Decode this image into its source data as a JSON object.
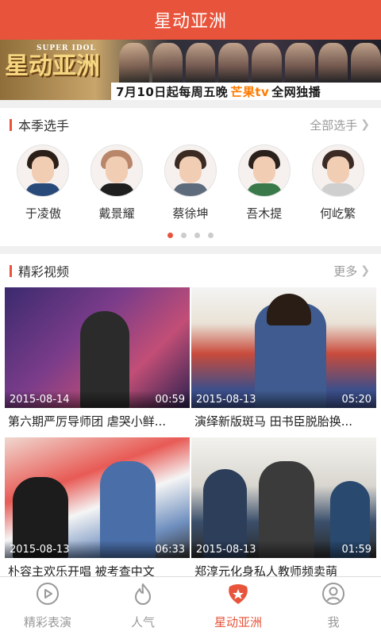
{
  "header": {
    "title": "星动亚洲"
  },
  "banner": {
    "logo_text": "星动亚洲",
    "logo_sub": "SUPER IDOL",
    "slogan_prefix": "7月10日起每周五晚",
    "slogan_brand": "芒果tv",
    "slogan_suffix": "全网独播"
  },
  "season": {
    "title": "本季选手",
    "more_label": "全部选手",
    "players": [
      {
        "name": "于凌傲"
      },
      {
        "name": "戴景耀"
      },
      {
        "name": "蔡徐坤"
      },
      {
        "name": "吾木提"
      },
      {
        "name": "何屹繁"
      }
    ],
    "page_count": 4,
    "active_page": 1
  },
  "videos": {
    "title": "精彩视频",
    "more_label": "更多",
    "items": [
      {
        "date": "2015-08-14",
        "duration": "00:59",
        "title": "第六期严厉导师团 虐哭小鲜..."
      },
      {
        "date": "2015-08-13",
        "duration": "05:20",
        "title": "演绎新版斑马 田书臣脱胎换..."
      },
      {
        "date": "2015-08-13",
        "duration": "06:33",
        "title": "朴容主欢乐开唱 被考查中文"
      },
      {
        "date": "2015-08-13",
        "duration": "01:59",
        "title": "郑淳元化身私人教师频卖萌"
      }
    ]
  },
  "tabbar": {
    "items": [
      {
        "label": "精彩表演",
        "icon": "play-circle-icon"
      },
      {
        "label": "人气",
        "icon": "flame-icon"
      },
      {
        "label": "星动亚洲",
        "icon": "star-badge-icon"
      },
      {
        "label": "我",
        "icon": "user-icon"
      }
    ],
    "active_index": 2
  },
  "colors": {
    "accent": "#e8543b",
    "text": "#333333",
    "muted": "#999999"
  }
}
